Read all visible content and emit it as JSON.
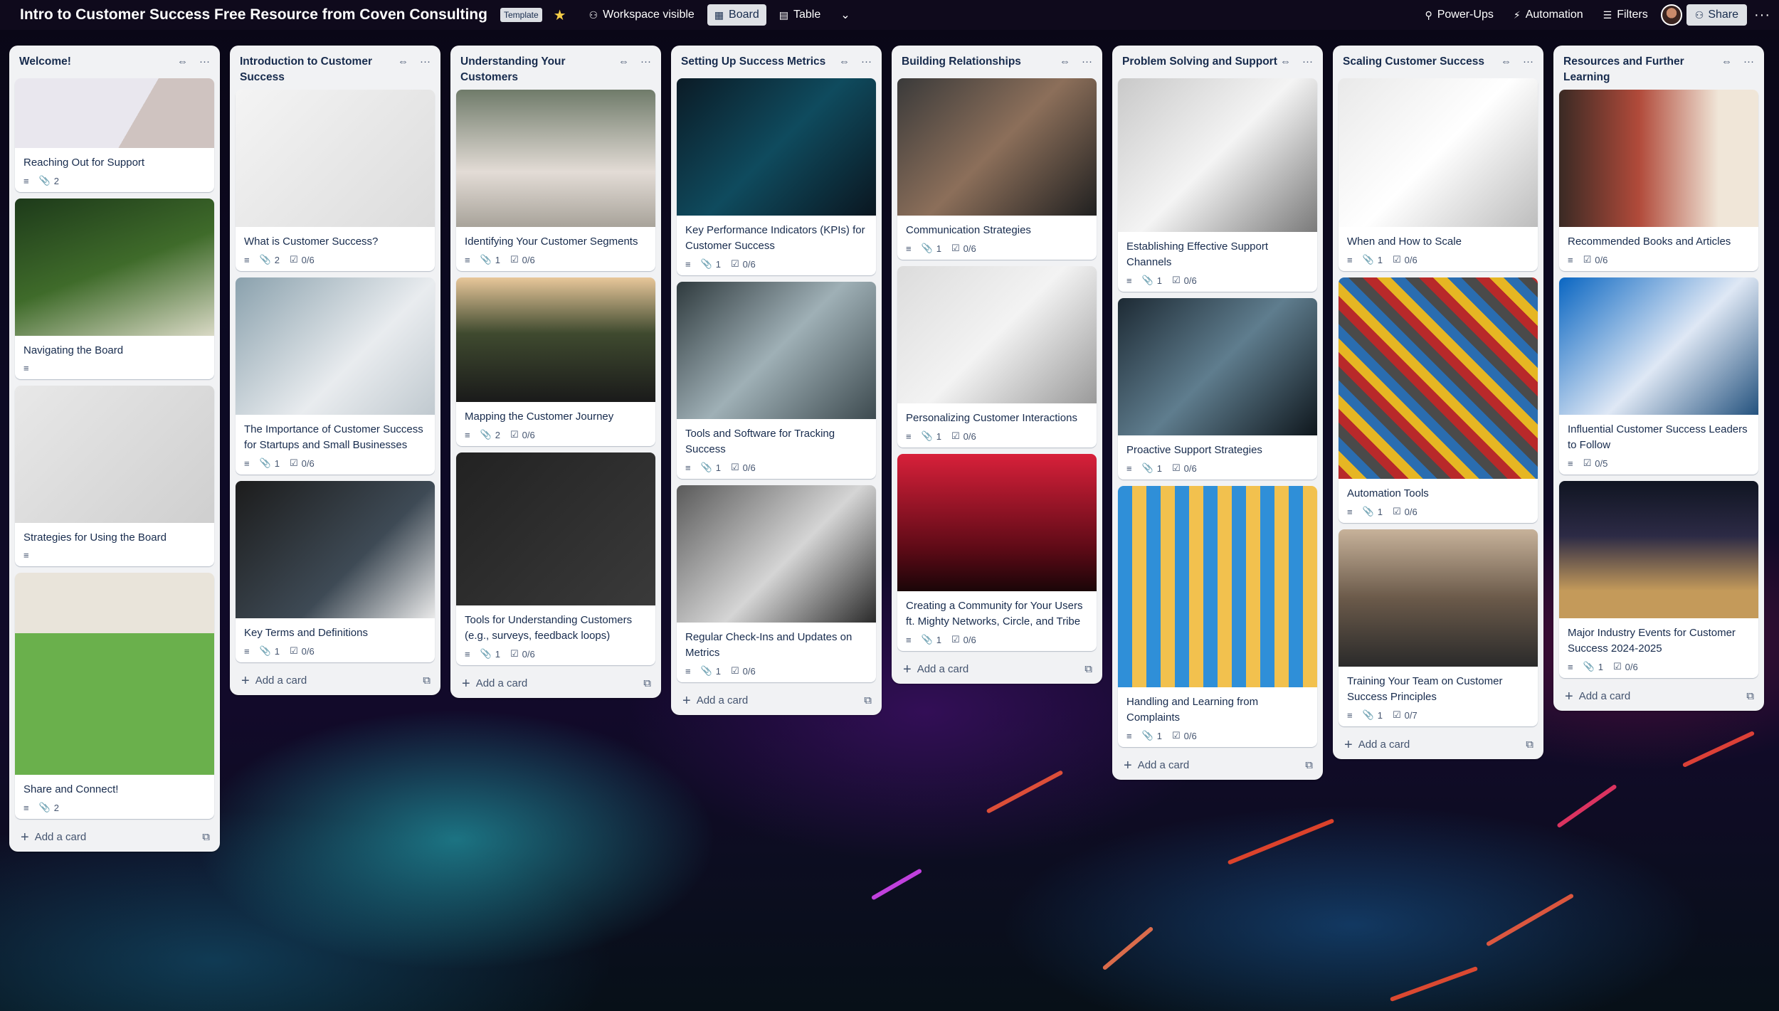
{
  "header": {
    "title": "Intro to Customer Success Free Resource from Coven Consulting",
    "template_badge": "Template",
    "visibility": "Workspace visible",
    "view_board": "Board",
    "view_table": "Table",
    "powerups": "Power-Ups",
    "automation": "Automation",
    "filters": "Filters",
    "share": "Share"
  },
  "icons": {
    "star": "★",
    "visibility": "⚇",
    "board": "▦",
    "table": "▤",
    "chevron": "⌄",
    "powerups": "⚲",
    "automation": "⚡",
    "filters": "☰",
    "share": "⚇",
    "more": "···",
    "collapse": "⇔",
    "description": "≡",
    "attachment": "📎",
    "checklist": "☑",
    "add": "+",
    "template": "⧉"
  },
  "colors": {
    "list_bg": "#f1f2f4",
    "card_bg": "#ffffff",
    "text": "#172b4d",
    "muted": "#44546f",
    "star": "#f5cd47"
  },
  "add_card_label": "Add a card",
  "lists": [
    {
      "title": "Welcome!",
      "cards": [
        {
          "title": "Reaching Out for Support",
          "attachments": "2",
          "checklist": ""
        },
        {
          "title": "Navigating the Board",
          "attachments": "",
          "checklist": ""
        },
        {
          "title": "Strategies for Using the Board",
          "attachments": "",
          "checklist": ""
        },
        {
          "title": "Share and Connect!",
          "attachments": "2",
          "checklist": ""
        }
      ]
    },
    {
      "title": "Introduction to Customer Success",
      "cards": [
        {
          "title": "What is Customer Success?",
          "attachments": "2",
          "checklist": "0/6"
        },
        {
          "title": "The Importance of Customer Success for Startups and Small Businesses",
          "attachments": "1",
          "checklist": "0/6"
        },
        {
          "title": "Key Terms and Definitions",
          "attachments": "1",
          "checklist": "0/6"
        }
      ]
    },
    {
      "title": "Understanding Your Customers",
      "cards": [
        {
          "title": "Identifying Your Customer Segments",
          "attachments": "1",
          "checklist": "0/6"
        },
        {
          "title": "Mapping the Customer Journey",
          "attachments": "2",
          "checklist": "0/6"
        },
        {
          "title": "Tools for Understanding Customers (e.g., surveys, feedback loops)",
          "attachments": "1",
          "checklist": "0/6"
        }
      ]
    },
    {
      "title": "Setting Up Success Metrics",
      "cards": [
        {
          "title": "Key Performance Indicators (KPIs) for Customer Success",
          "attachments": "1",
          "checklist": "0/6"
        },
        {
          "title": "Tools and Software for Tracking Success",
          "attachments": "1",
          "checklist": "0/6"
        },
        {
          "title": "Regular Check-Ins and Updates on Metrics",
          "attachments": "1",
          "checklist": "0/6"
        }
      ]
    },
    {
      "title": "Building Relationships",
      "cards": [
        {
          "title": "Communication Strategies",
          "attachments": "1",
          "checklist": "0/6"
        },
        {
          "title": "Personalizing Customer Interactions",
          "attachments": "1",
          "checklist": "0/6"
        },
        {
          "title": "Creating a Community for Your Users ft. Mighty Networks, Circle, and Tribe",
          "attachments": "1",
          "checklist": "0/6"
        }
      ]
    },
    {
      "title": "Problem Solving and Support",
      "cards": [
        {
          "title": "Establishing Effective Support Channels",
          "attachments": "1",
          "checklist": "0/6"
        },
        {
          "title": "Proactive Support Strategies",
          "attachments": "1",
          "checklist": "0/6"
        },
        {
          "title": "Handling and Learning from Complaints",
          "attachments": "1",
          "checklist": "0/6"
        }
      ]
    },
    {
      "title": "Scaling Customer Success",
      "cards": [
        {
          "title": "When and How to Scale",
          "attachments": "1",
          "checklist": "0/6"
        },
        {
          "title": "Automation Tools",
          "attachments": "1",
          "checklist": "0/6"
        },
        {
          "title": "Training Your Team on Customer Success Principles",
          "attachments": "1",
          "checklist": "0/7"
        }
      ]
    },
    {
      "title": "Resources and Further Learning",
      "cards": [
        {
          "title": "Recommended Books and Articles",
          "attachments": "",
          "checklist": "0/6"
        },
        {
          "title": "Influential Customer Success Leaders to Follow",
          "attachments": "",
          "checklist": "0/5"
        },
        {
          "title": "Major Industry Events for Customer Success 2024-2025",
          "attachments": "1",
          "checklist": "0/6"
        }
      ]
    }
  ]
}
